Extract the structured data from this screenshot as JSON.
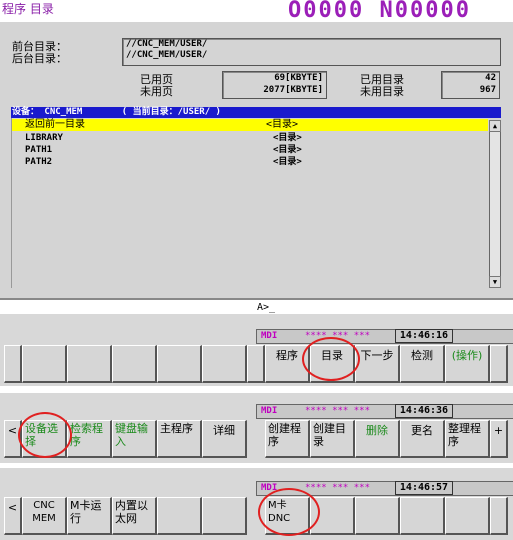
{
  "header": {
    "title": "程序 目录",
    "program_number": "O0000 N00000"
  },
  "directories": {
    "foreground_label": "前台目录：",
    "background_label": "后台目录：",
    "foreground_path": "//CNC_MEM/USER/",
    "background_path": "//CNC_MEM/USER/"
  },
  "stats": {
    "used_pages_label": "已用页",
    "free_pages_label": "未用页",
    "used_pages_value": "69[KBYTE]",
    "free_pages_value": "2077[KBYTE]",
    "used_dirs_label": "已用目录",
    "free_dirs_label": "未用目录",
    "used_dirs_value": "42",
    "free_dirs_value": "967"
  },
  "device_bar": {
    "device": "设备： CNC_MEM",
    "current": "( 当前目录：/USER/ )"
  },
  "list": [
    {
      "name": "返回前一目录",
      "type": "<目录>"
    },
    {
      "name": "LIBRARY",
      "type": "<目录>"
    },
    {
      "name": "PATH1",
      "type": "<目录>"
    },
    {
      "name": "PATH2",
      "type": "<目录>"
    }
  ],
  "input_line": "A>_",
  "status": {
    "mode": "MDI",
    "stars": "**** *** ***"
  },
  "softkey_rows": [
    {
      "time": "14:46:16",
      "keys": [
        "",
        "",
        "",
        "",
        "",
        "",
        "",
        "程序",
        "目录",
        "下一步",
        "检测",
        "(操作)",
        ""
      ]
    },
    {
      "time": "14:46:36",
      "keys": [
        "<",
        "设备选择",
        "检索程序",
        "键盘输入",
        "主程序",
        "详细",
        "创建程序",
        "创建目录",
        "删除",
        "更名",
        "整理程序",
        "+"
      ]
    },
    {
      "time": "14:46:57",
      "keys": [
        "<",
        "CNC MEM",
        "M卡运行",
        "内置以太网",
        "",
        "",
        "M卡 DNC",
        "",
        "",
        "",
        "",
        ""
      ]
    }
  ]
}
